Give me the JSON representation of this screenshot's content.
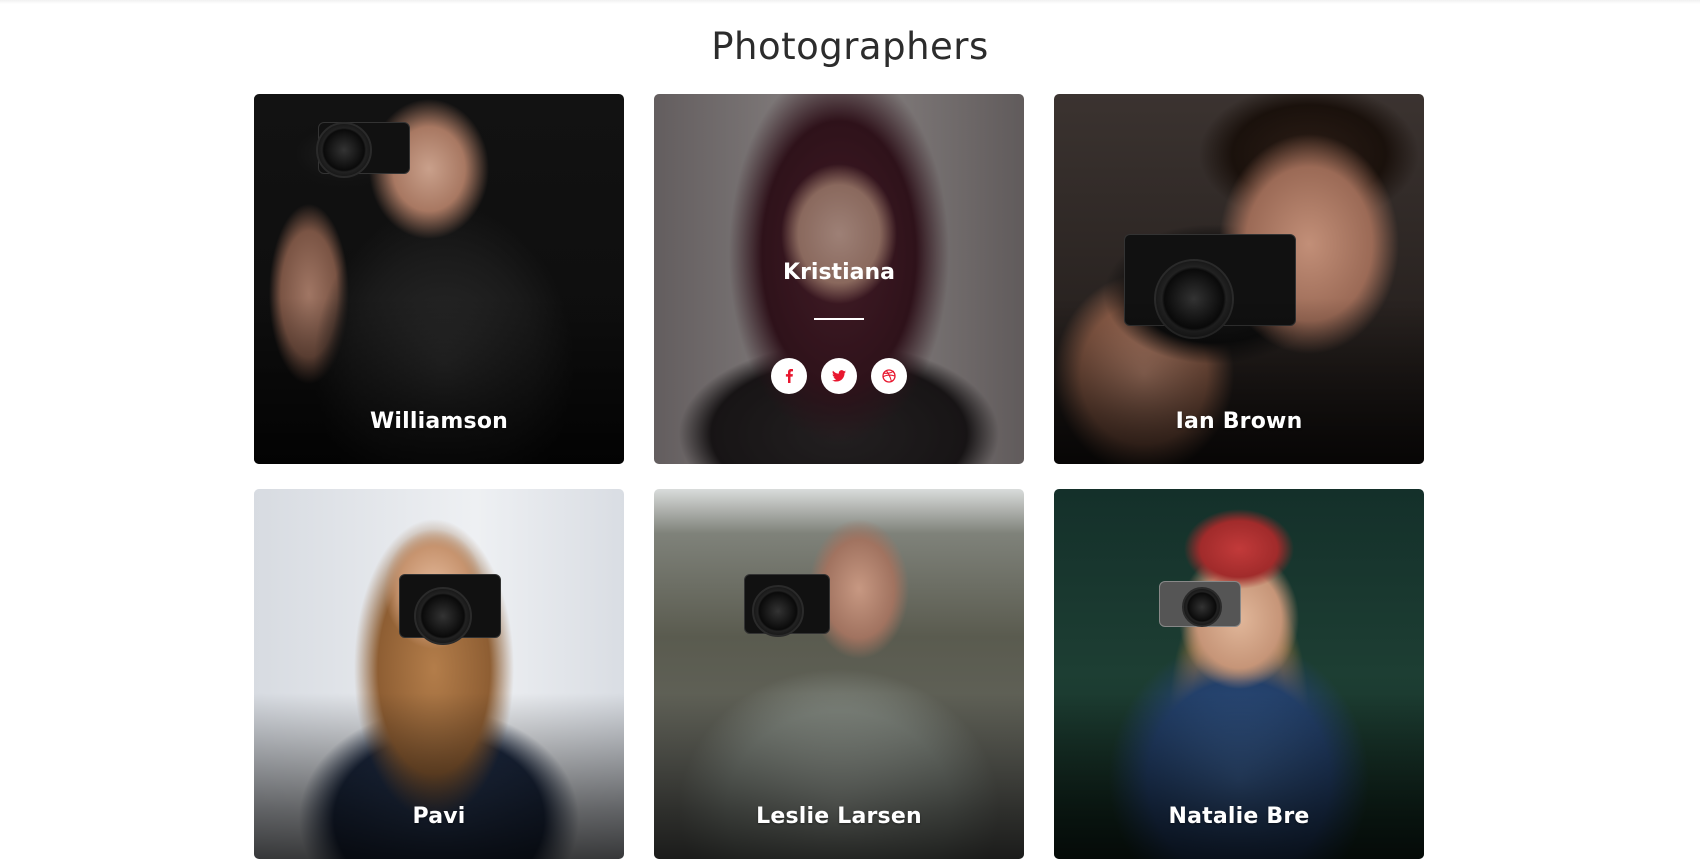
{
  "page": {
    "title": "Photographers"
  },
  "photographers": [
    {
      "name": "Williamson"
    },
    {
      "name": "Kristiana"
    },
    {
      "name": "Ian Brown"
    },
    {
      "name": "Pavi"
    },
    {
      "name": "Leslie Larsen"
    },
    {
      "name": "Natalie Bre"
    }
  ],
  "social_icons": [
    "facebook-icon",
    "twitter-icon",
    "dribbble-icon"
  ],
  "colors": {
    "accent": "#e8172f",
    "title": "#2c2c2c",
    "card_text": "#ffffff"
  }
}
